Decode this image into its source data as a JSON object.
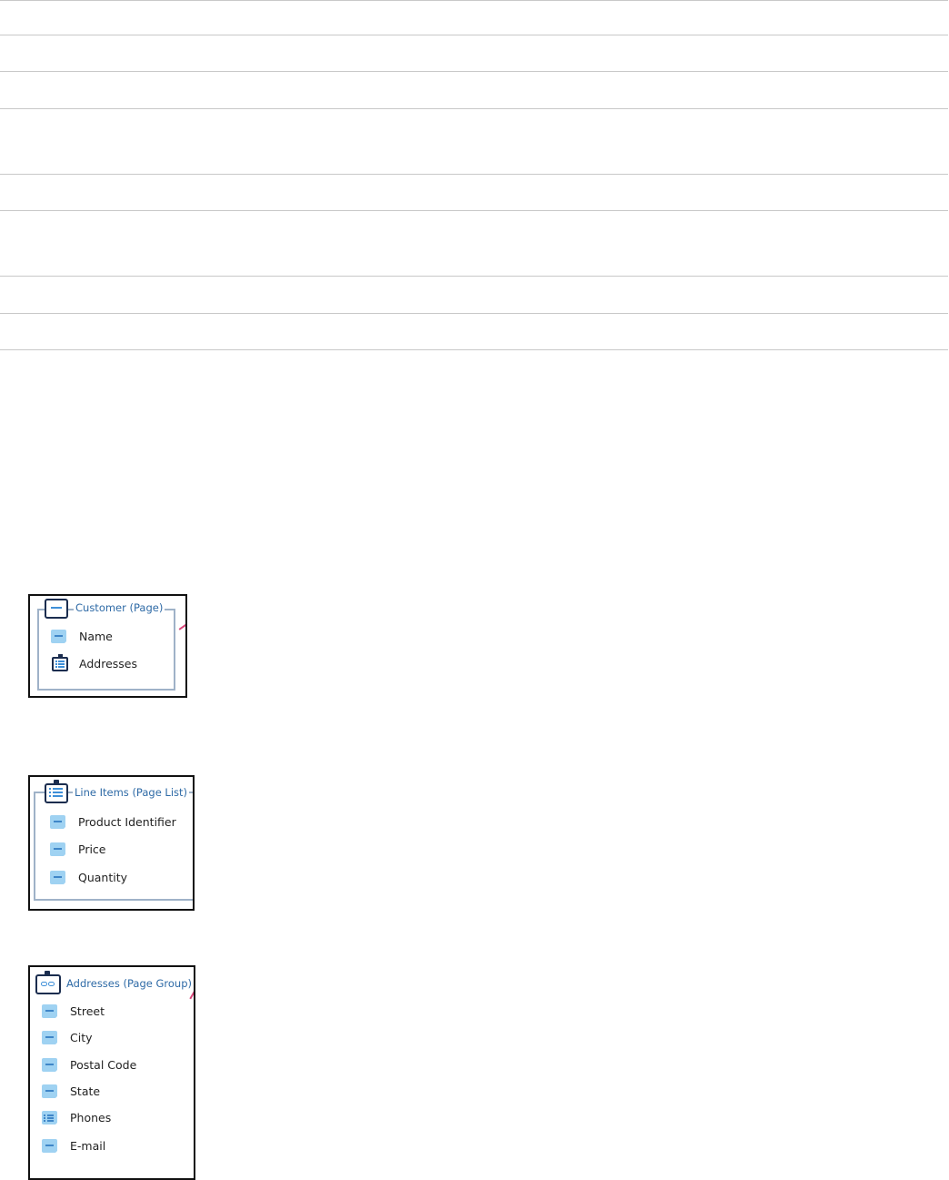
{
  "customer_card": {
    "title": "Customer (Page)",
    "items": [
      {
        "label": "Name",
        "icon": "property-icon"
      },
      {
        "label": "Addresses",
        "icon": "page-list-icon"
      }
    ]
  },
  "line_items_card": {
    "title": "Line Items (Page List)",
    "items": [
      {
        "label": "Product Identifier",
        "icon": "property-icon"
      },
      {
        "label": "Price",
        "icon": "property-icon"
      },
      {
        "label": "Quantity",
        "icon": "property-icon"
      }
    ]
  },
  "addresses_card": {
    "title": "Addresses (Page Group)",
    "items": [
      {
        "label": "Street",
        "icon": "property-icon"
      },
      {
        "label": "City",
        "icon": "property-icon"
      },
      {
        "label": "Postal Code",
        "icon": "property-icon"
      },
      {
        "label": "State",
        "icon": "property-icon"
      },
      {
        "label": "Phones",
        "icon": "value-list-icon"
      },
      {
        "label": "E-mail",
        "icon": "property-icon"
      }
    ]
  },
  "colors": {
    "card_border": "#111111",
    "frame": "#9fb2c8",
    "title_text": "#2e6aa6",
    "icon_dark": "#1b2d4f",
    "icon_light": "#9fd2f2",
    "connector": "#d9467a",
    "rule": "#c8c8c8"
  }
}
